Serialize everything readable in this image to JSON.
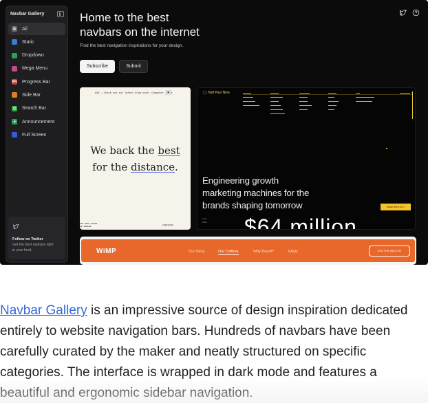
{
  "sidebar": {
    "brand": "Navbar Gallery",
    "items": [
      {
        "label": "All",
        "icon": "all-icon",
        "color": "#6b6b70",
        "glyph": "◎",
        "active": true
      },
      {
        "label": "Static",
        "icon": "static-icon",
        "color": "#3a7bd5",
        "glyph": "",
        "active": false
      },
      {
        "label": "Dropdown",
        "icon": "dropdown-icon",
        "color": "#2e9e5a",
        "glyph": "",
        "active": false
      },
      {
        "label": "Mega Menu",
        "icon": "mega-menu-icon",
        "color": "#c04a8c",
        "glyph": "",
        "active": false
      },
      {
        "label": "Progress Bar",
        "icon": "progress-bar-icon",
        "color": "#c9402f",
        "glyph": "6%",
        "active": false
      },
      {
        "label": "Side Bar",
        "icon": "side-bar-icon",
        "color": "#d9802a",
        "glyph": "",
        "active": false
      },
      {
        "label": "Search Bar",
        "icon": "search-icon",
        "color": "#3aa84a",
        "glyph": "Q",
        "active": false
      },
      {
        "label": "Announcement",
        "icon": "announcement-icon",
        "color": "#2f9c58",
        "glyph": "◂",
        "active": false
      },
      {
        "label": "Full Screen",
        "icon": "full-screen-icon",
        "color": "#3a5bd8",
        "glyph": "",
        "active": false
      }
    ],
    "footer": {
      "title": "Follow on Twitter",
      "line1": "Get the best navbars right",
      "line2": "in your feed."
    }
  },
  "header": {
    "title_line1": "Home to the best",
    "title_line2": "navbars on the internet",
    "subtitle": "Find the best navigation inspirations for your design.",
    "subscribe_label": "Subscribe",
    "submit_label": "Submit"
  },
  "card1": {
    "topbar": "ASK  →  Check out our latest blog post: Computer Fonts",
    "line1_a": "We back the ",
    "line1_b": "best",
    "line2_a": "for the ",
    "line2_b": "distance",
    "line2_c": "."
  },
  "card2": {
    "logo": "Half Past Nine",
    "headline_1": "Engineering growth",
    "headline_2": "marketing machines for the",
    "headline_3": "brands shaping tomorrow",
    "cta": "WORK WITH US ↗",
    "big_number": "$64 million"
  },
  "card3": {
    "logo": "WiMP",
    "nav": [
      "Our Story",
      "Our Coffees",
      "Why Decaf?",
      "FAQs"
    ],
    "waitlist": "JOIN THE WAITLIST"
  },
  "article": {
    "link_text": "Navbar Gallery",
    "body": " is an impressive source of design inspiration dedicated entirely to website navigation bars. Hundreds of navbars have been carefully curated by the maker and neatly structured on specific categories. The interface is wrapped in dark mode and features a beautiful and ergonomic sidebar navigation."
  }
}
